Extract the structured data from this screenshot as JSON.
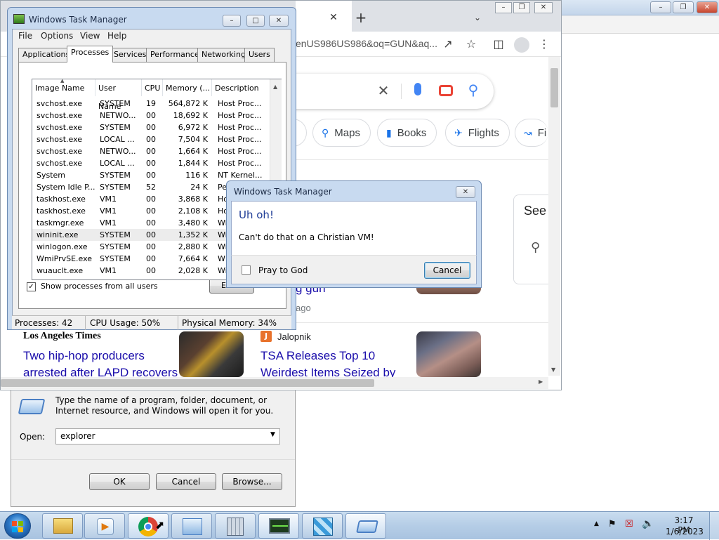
{
  "browser": {
    "url_fragment": "enUS986US986&oq=GUN&aq...",
    "chips": [
      {
        "label": "Maps",
        "icon": "map-pin-icon"
      },
      {
        "label": "Books",
        "icon": "book-icon"
      },
      {
        "label": "Flights",
        "icon": "airplane-icon"
      },
      {
        "label": "Fi",
        "icon": "finance-icon"
      }
    ],
    "see_label": "See",
    "partial_result_text": "g gun",
    "partial_result_time": "ago",
    "news": [
      {
        "source": "Los Angeles Times",
        "headline_line1": "Two hip-hop producers",
        "headline_line2": "arrested after LAPD recovers"
      },
      {
        "source": "Jalopnik",
        "headline_line1": "TSA Releases Top 10",
        "headline_line2": "Weirdest Items Seized by"
      }
    ]
  },
  "task_manager": {
    "title": "Windows Task Manager",
    "menu": [
      "File",
      "Options",
      "View",
      "Help"
    ],
    "tabs": [
      "Applications",
      "Processes",
      "Services",
      "Performance",
      "Networking",
      "Users"
    ],
    "active_tab": "Processes",
    "columns": [
      "Image Name",
      "User Name",
      "CPU",
      "Memory (...",
      "Description"
    ],
    "processes": [
      {
        "image": "svchost.exe",
        "user": "SYSTEM",
        "cpu": "19",
        "mem": "564,872 K",
        "desc": "Host Proc..."
      },
      {
        "image": "svchost.exe",
        "user": "NETWO...",
        "cpu": "00",
        "mem": "18,692 K",
        "desc": "Host Proc..."
      },
      {
        "image": "svchost.exe",
        "user": "SYSTEM",
        "cpu": "00",
        "mem": "6,972 K",
        "desc": "Host Proc..."
      },
      {
        "image": "svchost.exe",
        "user": "LOCAL ...",
        "cpu": "00",
        "mem": "7,504 K",
        "desc": "Host Proc..."
      },
      {
        "image": "svchost.exe",
        "user": "NETWO...",
        "cpu": "00",
        "mem": "1,664 K",
        "desc": "Host Proc..."
      },
      {
        "image": "svchost.exe",
        "user": "LOCAL ...",
        "cpu": "00",
        "mem": "1,844 K",
        "desc": "Host Proc..."
      },
      {
        "image": "System",
        "user": "SYSTEM",
        "cpu": "00",
        "mem": "116 K",
        "desc": "NT Kernel..."
      },
      {
        "image": "System Idle P...",
        "user": "SYSTEM",
        "cpu": "52",
        "mem": "24 K",
        "desc": "Percenta..."
      },
      {
        "image": "taskhost.exe",
        "user": "VM1",
        "cpu": "00",
        "mem": "3,868 K",
        "desc": "Hos"
      },
      {
        "image": "taskhost.exe",
        "user": "VM1",
        "cpu": "00",
        "mem": "2,108 K",
        "desc": "Hos"
      },
      {
        "image": "taskmgr.exe",
        "user": "VM1",
        "cpu": "00",
        "mem": "3,480 K",
        "desc": "Win"
      },
      {
        "image": "wininit.exe",
        "user": "SYSTEM",
        "cpu": "00",
        "mem": "1,352 K",
        "desc": "Win"
      },
      {
        "image": "winlogon.exe",
        "user": "SYSTEM",
        "cpu": "00",
        "mem": "2,880 K",
        "desc": "Win"
      },
      {
        "image": "WmiPrvSE.exe",
        "user": "SYSTEM",
        "cpu": "00",
        "mem": "7,664 K",
        "desc": "WM"
      },
      {
        "image": "wuauclt.exe",
        "user": "VM1",
        "cpu": "00",
        "mem": "2,028 K",
        "desc": "Win"
      }
    ],
    "selected_row": 11,
    "show_all_label": "Show processes from all users",
    "show_all_checked": true,
    "end_button_label": "E",
    "status": {
      "processes": "Processes: 42",
      "cpu": "CPU Usage: 50%",
      "memory": "Physical Memory: 34%"
    }
  },
  "error_dialog": {
    "title": "Windows Task Manager",
    "heading": "Uh oh!",
    "message": "Can't do that on a Christian VM!",
    "checkbox_label": "Pray to God",
    "cancel_label": "Cancel"
  },
  "run_dialog": {
    "description": "Type the name of a program, folder, document, or Internet resource, and Windows will open it for you.",
    "open_label": "Open:",
    "open_value": "explorer",
    "ok_label": "OK",
    "cancel_label": "Cancel",
    "browse_label": "Browse..."
  },
  "taskbar": {
    "time": "3:17 PM",
    "date": "1/6/2023"
  },
  "colors": {
    "accent_blue": "#1a73e8",
    "link": "#1a0dab",
    "dialog_heading": "#1e3c96"
  }
}
